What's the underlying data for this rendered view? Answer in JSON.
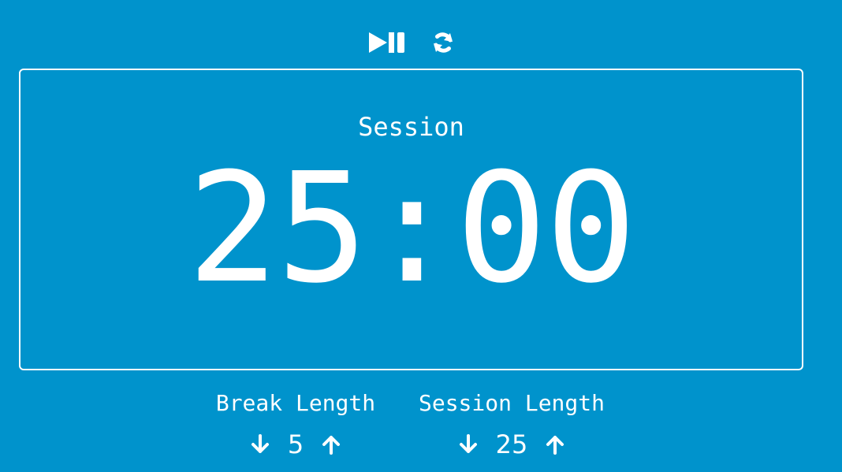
{
  "controls": {
    "play_pause_icon": "play-pause-icon",
    "refresh_icon": "refresh-icon"
  },
  "timer": {
    "label": "Session",
    "time_left": "25:00"
  },
  "break_length": {
    "title": "Break Length",
    "value": "5",
    "decrement_icon": "arrow-down-icon",
    "increment_icon": "arrow-up-icon"
  },
  "session_length": {
    "title": "Session Length",
    "value": "25",
    "decrement_icon": "arrow-down-icon",
    "increment_icon": "arrow-up-icon"
  },
  "colors": {
    "background": "#0093cc",
    "foreground": "#ffffff"
  }
}
